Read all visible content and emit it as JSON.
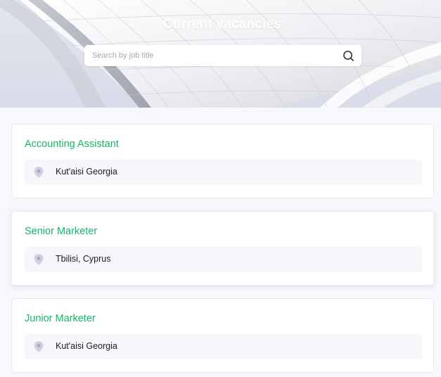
{
  "header": {
    "title": "Current vacancies",
    "search_placeholder": "Search by job title",
    "search_value": ""
  },
  "vacancies": [
    {
      "title": "Accounting Assistant",
      "location": "Kut'aisi Georgia"
    },
    {
      "title": "Senior Marketer",
      "location": "Tbilisi, Cyprus"
    },
    {
      "title": "Junior Marketer",
      "location": "Kut'aisi Georgia"
    }
  ],
  "icons": {
    "search": "search-icon",
    "location": "location-pin-icon"
  },
  "colors": {
    "accent": "#12b76a",
    "page_background": "#f7f8fb",
    "pin": "#c9c8db"
  }
}
